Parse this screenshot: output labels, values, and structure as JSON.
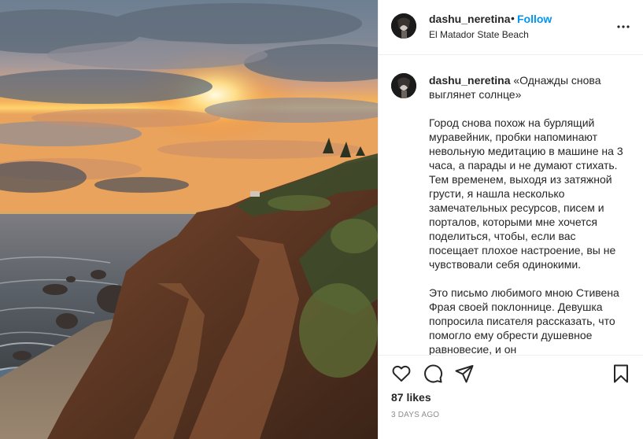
{
  "post": {
    "photo_alt": "",
    "username": "dashu_neretina",
    "separator": "•",
    "follow_label": "Follow",
    "location": "El Matador State Beach",
    "caption": {
      "username": "dashu_neretina",
      "title": "«Однажды снова выглянет солнце»",
      "paragraph_1": "Город снова похож на бурлящий муравейник, пробки напоминают невольную медитацию в машине на 3 часа, а парады и не думают стихать. Тем временем, выходя из затяжной грусти, я нашла несколько замечательных ресурсов, писем и порталов, которыми мне хочется поделиться, чтобы, если вас посещает плохое настроение, вы не чувствовали себя одинокими.",
      "paragraph_2": "Это письмо любимого мною Стивена Фрая своей поклоннице. Девушка попросила писателя рассказать, что помогло ему обрести душевное равновесие, и он"
    },
    "likes": "87 likes",
    "timestamp": "3 DAYS AGO"
  },
  "icons": {
    "more": "more-options-icon",
    "like": "heart-icon",
    "comment": "comment-icon",
    "share": "paper-plane-icon",
    "save": "bookmark-icon"
  },
  "colors": {
    "link_blue": "#0095f6",
    "text": "#262626",
    "muted": "#8e8e8e",
    "divider": "#efefef"
  }
}
